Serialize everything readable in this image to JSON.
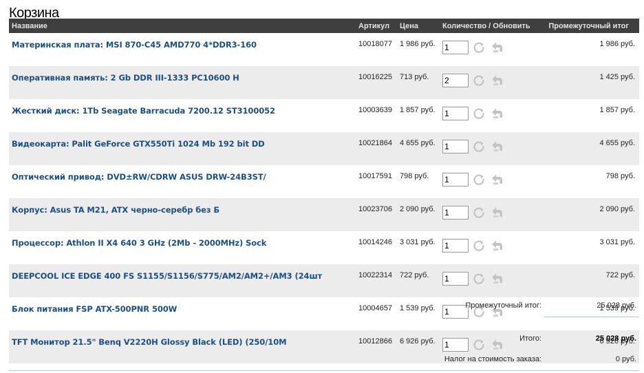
{
  "page": {
    "title": "Корзина"
  },
  "table": {
    "headers": {
      "name": "Название",
      "sku": "Артикул",
      "price": "Цена",
      "qty": "Количество / Обновить",
      "subtotal": "Промежуточный итог"
    },
    "rows": [
      {
        "name": "Материнская плата: MSI 870-C45 AMD770 4*DDR3-160",
        "sku": "10018077",
        "price": "1 986 руб.",
        "qty": "1",
        "subtotal": "1 986 руб."
      },
      {
        "name": "Оперативная память: 2 Gb DDR III-1333 PC10600 H",
        "sku": "10016225",
        "price": "713 руб.",
        "qty": "2",
        "subtotal": "1 425 руб."
      },
      {
        "name": "Жесткий диск: 1Tb Seagate Barracuda 7200.12 ST3100052",
        "sku": "10003639",
        "price": "1 857 руб.",
        "qty": "1",
        "subtotal": "1 857 руб."
      },
      {
        "name": "Видеокарта: Palit GeForce GTX550Ti 1024 Mb 192 bit DD",
        "sku": "10021864",
        "price": "4 655 руб.",
        "qty": "1",
        "subtotal": "4 655 руб."
      },
      {
        "name": "Оптический привод: DVD±RW/CDRW ASUS DRW-24B3ST/",
        "sku": "10017591",
        "price": "798 руб.",
        "qty": "1",
        "subtotal": "798 руб."
      },
      {
        "name": "Корпус: Asus TA M21, ATX черно-серебр без Б",
        "sku": "10023706",
        "price": "2 090 руб.",
        "qty": "1",
        "subtotal": "2 090 руб."
      },
      {
        "name": "Процессор: Athlon II X4 640 3 GHz (2Mb - 2000MHz) Sock",
        "sku": "10014246",
        "price": "3 031 руб.",
        "qty": "1",
        "subtotal": "3 031 руб."
      },
      {
        "name": "DEEPCOOL ICE EDGE 400 FS S1155/S1156/S775/AM2/AM2+/AM3 (24шт",
        "sku": "10022314",
        "price": "722 руб.",
        "qty": "1",
        "subtotal": "722 руб."
      },
      {
        "name": "Блок питания FSP ATX-500PNR 500W",
        "sku": "10004657",
        "price": "1 539 руб.",
        "qty": "1",
        "subtotal": "1 539 руб."
      },
      {
        "name": "TFT Монитор 21.5\" Benq V2220H Glossy Black (LED) (250/10M",
        "sku": "10012866",
        "price": "6 926 руб.",
        "qty": "1",
        "subtotal": "6 926 руб."
      }
    ]
  },
  "totals": {
    "subtotal_label": "Промежуточный итог:",
    "subtotal_value": "25 028 руб.",
    "total_label": "Итого:",
    "total_value": "25 028 руб.",
    "tax_label": "Налог на стоимость заказа:",
    "tax_value": "0 руб."
  },
  "icons": {
    "update": "refresh-icon",
    "remove": "remove-arrow-icon"
  },
  "colors": {
    "header_bg": "#3f3f3f",
    "link": "#1a4f8a",
    "row_alt": "#ececec"
  }
}
